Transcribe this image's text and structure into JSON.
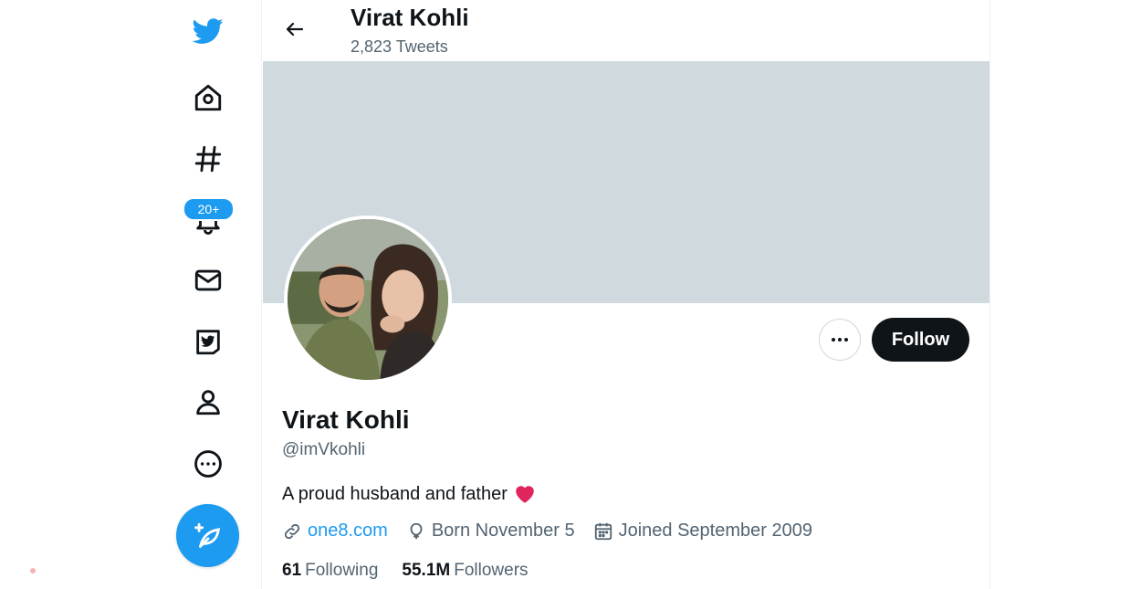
{
  "header": {
    "name": "Virat Kohli",
    "tweet_count": "2,823 Tweets"
  },
  "nav": {
    "notifications_badge": "20+"
  },
  "profile": {
    "name": "Virat Kohli",
    "handle": "@imVkohli",
    "bio": "A proud husband and father",
    "website": "one8.com",
    "birthday": "Born November 5",
    "joined": "Joined September 2009",
    "following_count": "61",
    "following_label": "Following",
    "followers_count": "55.1M",
    "followers_label": "Followers"
  },
  "actions": {
    "follow_label": "Follow"
  },
  "colors": {
    "accent": "#1d9bf0",
    "banner": "#cfd9de",
    "heart": "#f91880"
  },
  "icons": [
    "twitter-logo-icon",
    "home-icon",
    "hashtag-icon",
    "bell-icon",
    "mail-icon",
    "twitter-blue-icon",
    "profile-icon",
    "more-circle-icon",
    "compose-icon",
    "back-arrow-icon",
    "ellipsis-icon",
    "link-icon",
    "balloon-icon",
    "calendar-icon",
    "heart-icon"
  ]
}
